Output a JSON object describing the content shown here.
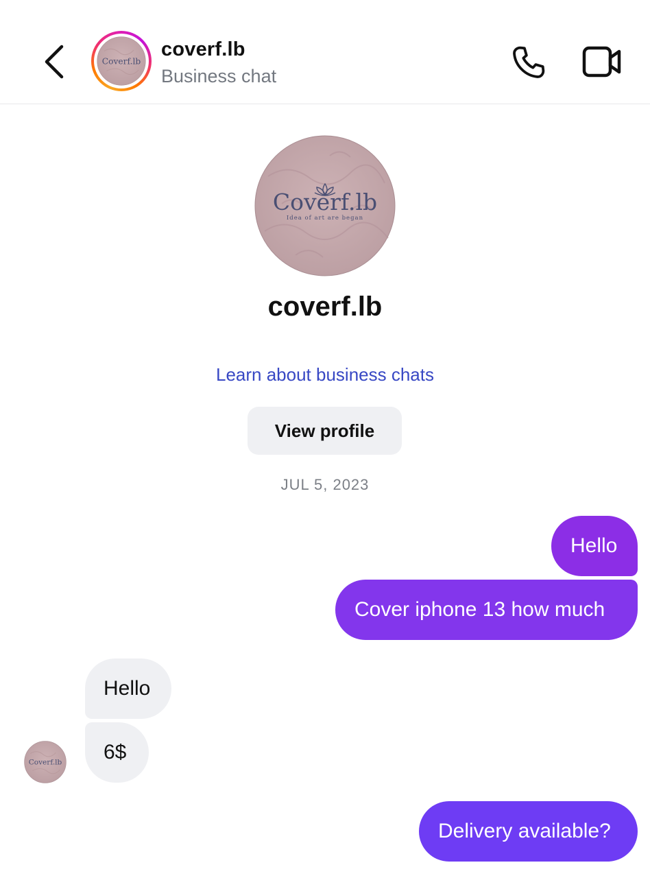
{
  "header": {
    "title": "coverf.lb",
    "subtitle": "Business chat"
  },
  "profile": {
    "name": "coverf.lb",
    "logo_text": "Coverf.lb",
    "logo_tagline": "Idea of art are began",
    "learn_link": "Learn about business chats",
    "view_profile_label": "View profile"
  },
  "conversation": {
    "date": "JUL 5, 2023",
    "messages": [
      {
        "from": "me",
        "text": "Hello"
      },
      {
        "from": "me",
        "text": "Cover iphone 13 how much"
      },
      {
        "from": "coverf.lb",
        "text": "Hello"
      },
      {
        "from": "coverf.lb",
        "text": "6$"
      },
      {
        "from": "me",
        "text": "Delivery available?"
      }
    ]
  },
  "icons": {
    "back": "chevron-left-icon",
    "call": "phone-icon",
    "video": "video-camera-icon"
  },
  "colors": {
    "outgoing_top": "#8c2ee6",
    "outgoing_mid": "#8336ec",
    "outgoing_bottom": "#6e3cf4",
    "incoming": "#eff0f3",
    "link": "#3848c4",
    "avatar_bg": "#c4a6aa",
    "logo_ink": "#4a4f73"
  }
}
